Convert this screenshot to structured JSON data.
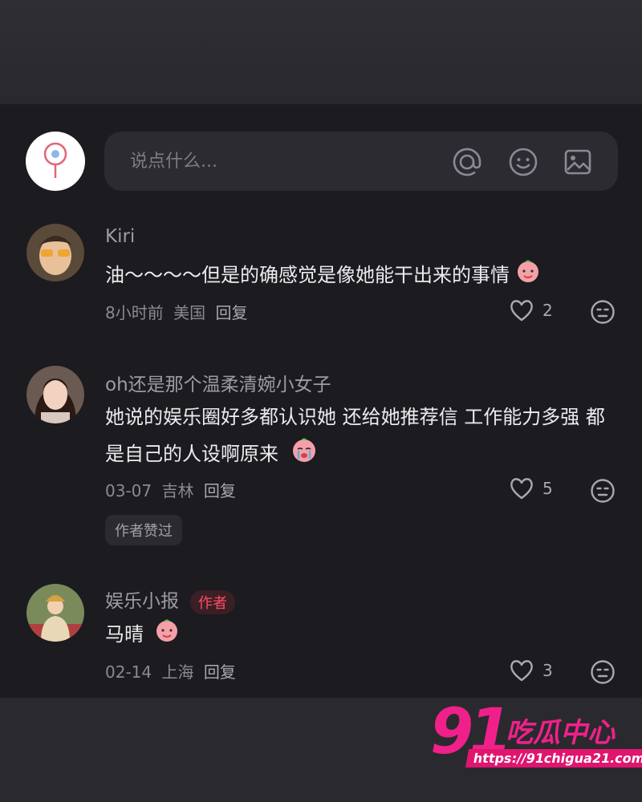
{
  "composer": {
    "placeholder": "说点什么...",
    "icons": [
      "at-icon",
      "emoji-icon",
      "image-icon"
    ]
  },
  "comments": [
    {
      "author": "Kiri",
      "text": "油～～～～但是的确感觉是像她能干出来的事情",
      "time": "8小时前",
      "location": "美国",
      "reply": "回复",
      "likes": "2"
    },
    {
      "author": "oh还是那个温柔清婉小女子",
      "text": "她说的娱乐圈好多都认识她 还给她推荐信 工作能力多强 都是自己的人设啊原来",
      "time": "03-07",
      "location": "吉林",
      "reply": "回复",
      "likes": "5",
      "tag": "作者赞过"
    },
    {
      "author": "娱乐小报",
      "badge": "作者",
      "text": "马晴",
      "time": "02-14",
      "location": "上海",
      "reply": "回复",
      "likes": "3"
    }
  ],
  "watermark": {
    "number": "91",
    "name": "吃瓜中心",
    "url": "https://91chigua21.com"
  },
  "colors": {
    "panel_bg": "#1b1b20",
    "input_bg": "#2b2b31",
    "accent": "#ff4d63",
    "watermark": "#f0208a"
  }
}
